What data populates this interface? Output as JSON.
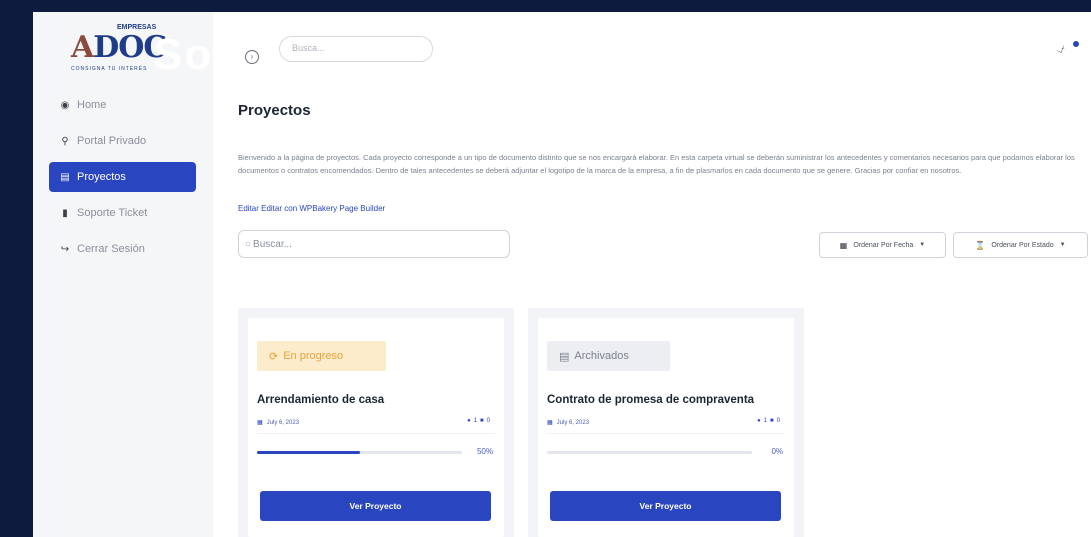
{
  "logo": {
    "top_text": "EMPRESAS",
    "mark": "DOC",
    "sub_text": "CONSIGNA TU INTERÉS",
    "overlay_text": "So"
  },
  "sidebar": {
    "items": [
      {
        "label": "Home",
        "icon": "palette-icon",
        "active": false
      },
      {
        "label": "Portal Privado",
        "icon": "key-icon",
        "active": false
      },
      {
        "label": "Proyectos",
        "icon": "chart-icon",
        "active": true
      },
      {
        "label": "Soporte Ticket",
        "icon": "ticket-icon",
        "active": false
      },
      {
        "label": "Cerrar Sesión",
        "icon": "logout-icon",
        "active": false
      }
    ]
  },
  "topbar": {
    "search_placeholder": "Busca..."
  },
  "page": {
    "title": "Proyectos",
    "intro": "Bienvenido a la página de proyectos. Cada proyecto corresponde a un tipo de documento distinto que se nos encargará elaborar. En esta carpeta virtual se deberán suministrar los antecedentes y comentarios necesarios para que podamos elaborar los documentos o contratos encomendados. Dentro de tales antecedentes se deberá adjuntar el logotipo de la marca de la empresa, a fin de plasmarlos en cada documento que se genere. Gracias por confiar en nosotros.",
    "edit_link": "Editar Editar con WPBakery Page Builder",
    "search_placeholder": "Buscar...",
    "sort_date": "Ordenar Por Fecha",
    "sort_status": "Ordenar Por Estado"
  },
  "projects": [
    {
      "status": "En progreso",
      "title": "Arrendamiento de casa",
      "date": "July 6, 2023",
      "users": "1",
      "comments": "0",
      "progress": 50,
      "progress_label": "50%",
      "button": "Ver Proyecto"
    },
    {
      "status": "Archivados",
      "title": "Contrato de promesa de compraventa",
      "date": "July 6, 2023",
      "users": "1",
      "comments": "0",
      "progress": 0,
      "progress_label": "0%",
      "button": "Ver Proyecto"
    }
  ],
  "colors": {
    "accent": "#2a45c0",
    "background": "#0d1b3e",
    "in_progress": "#e8a23b"
  }
}
